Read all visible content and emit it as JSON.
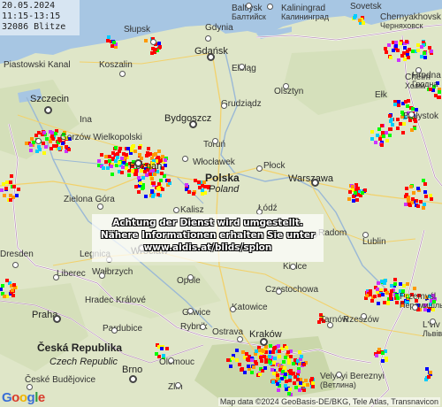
{
  "info": {
    "date": "20.05.2024",
    "time_range": "11:15-13:15",
    "strike_count": "32086 Blitze"
  },
  "notice": {
    "line1": "Achtung der Dienst wird umgestellt.",
    "line2": "Nähere Informationen erhalten Sie unter",
    "line3": "www.aldis.at/blids/splon"
  },
  "countries": {
    "poland": "Polska",
    "poland_sub": "Poland",
    "czech": "Česká Republika",
    "czech_sub": "Czech Republic"
  },
  "cities": [
    {
      "name": "Baltiysk",
      "alt": "Балтийск"
    },
    {
      "name": "Kaliningrad",
      "alt": "Калининград"
    },
    {
      "name": "Sovetsk"
    },
    {
      "name": "Chernyakhovsk",
      "alt": "Черняховск"
    },
    {
      "name": "Słupsk"
    },
    {
      "name": "Gdynia"
    },
    {
      "name": "Gdańsk"
    },
    {
      "name": "Elbląg"
    },
    {
      "name": "Koszalin"
    },
    {
      "name": "Olsztyn"
    },
    {
      "name": "Piastowski Kanal"
    },
    {
      "name": "Szczecin"
    },
    {
      "name": "Grudziądz"
    },
    {
      "name": "Ełk"
    },
    {
      "name": "Hrodna",
      "alt": "Гродна"
    },
    {
      "name": "Białystok"
    },
    {
      "name": "Bydgoszcz"
    },
    {
      "name": "Toruń"
    },
    {
      "name": "Ina"
    },
    {
      "name": "Gorzów Wielkopolski"
    },
    {
      "name": "Włocławek"
    },
    {
      "name": "Płock"
    },
    {
      "name": "Warszawa"
    },
    {
      "name": "Poznań"
    },
    {
      "name": "Zielona Góra"
    },
    {
      "name": "Łódź"
    },
    {
      "name": "Kalisz"
    },
    {
      "name": "Lublin"
    },
    {
      "name": "Dresden"
    },
    {
      "name": "Legnica"
    },
    {
      "name": "Wrocław"
    },
    {
      "name": "Radom"
    },
    {
      "name": "Kielce"
    },
    {
      "name": "Liberec"
    },
    {
      "name": "Wałbrzych"
    },
    {
      "name": "Opole"
    },
    {
      "name": "Częstochowa"
    },
    {
      "name": "Gliwice"
    },
    {
      "name": "Katowice"
    },
    {
      "name": "Hradec Králové"
    },
    {
      "name": "Rybnik"
    },
    {
      "name": "Praha"
    },
    {
      "name": "Pardubice"
    },
    {
      "name": "Tarnów"
    },
    {
      "name": "Rzeszów"
    },
    {
      "name": "Przemyśl",
      "alt": "Перемишль"
    },
    {
      "name": "Ostrava"
    },
    {
      "name": "Kraków"
    },
    {
      "name": "L'viv",
      "alt": "Львів"
    },
    {
      "name": "Brno"
    },
    {
      "name": "Olomouc"
    },
    {
      "name": "Zlín"
    },
    {
      "name": "České Budějovice"
    },
    {
      "name": "Velykyi Bereznyi",
      "alt": "(Ветлина)"
    },
    {
      "name": "Chełm",
      "alt": "Холм"
    }
  ],
  "attribution": "Map data ©2024 GeoBasis-DE/BKG, Tele Atlas, Transnavicon",
  "logo": "Google",
  "colors": {
    "land": "#dfe6c8",
    "sea": "#a7c6e3",
    "strike_recent": "#ff0000",
    "strike_mid": "#ff9900",
    "strike_old": "#ffff00",
    "strike_older": "#00ccff",
    "strike_oldest": "#cc33ff"
  }
}
